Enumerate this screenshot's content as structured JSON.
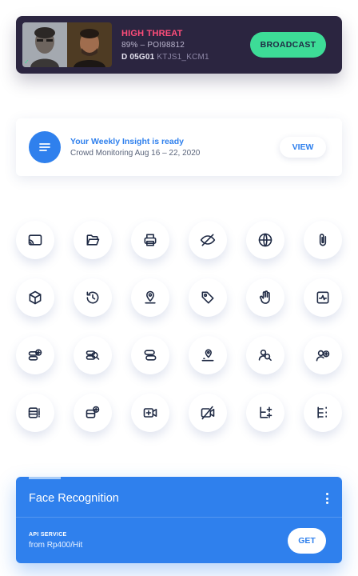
{
  "threat_card": {
    "level": "HIGH THREAT",
    "match_percent": "89%",
    "separator": "–",
    "poi_id": "POI98812",
    "device_id": "D 05G01",
    "camera_code": "KTJS1_KCM1",
    "broadcast_label": "BROADCAST",
    "accent_color": "#3ddc97",
    "threat_color": "#ff4d7a"
  },
  "insight": {
    "title": "Your Weekly Insight is ready",
    "subtitle": "Crowd Monitoring Aug 16 – 22, 2020",
    "view_label": "VIEW",
    "icon": "notes-icon"
  },
  "icon_grid": [
    [
      "cast-icon",
      "folder-open-icon",
      "printer-icon",
      "eye-off-icon",
      "globe-icon",
      "paperclip-icon"
    ],
    [
      "cube-icon",
      "history-icon",
      "location-pin-icon",
      "tag-icon",
      "hand-pointer-icon",
      "chart-box-icon"
    ],
    [
      "server-add-icon",
      "server-search-icon",
      "server-icon",
      "user-pin-icon",
      "user-search-icon",
      "user-add-icon"
    ],
    [
      "list-add-icon",
      "layers-add-icon",
      "video-add-icon",
      "video-off-icon",
      "hierarchy-add-icon",
      "hierarchy-list-icon"
    ]
  ],
  "api_card": {
    "title": "Face Recognition",
    "label": "API SERVICE",
    "price": "from Rp400/Hit",
    "get_label": "GET",
    "color": "#2f80ed"
  }
}
